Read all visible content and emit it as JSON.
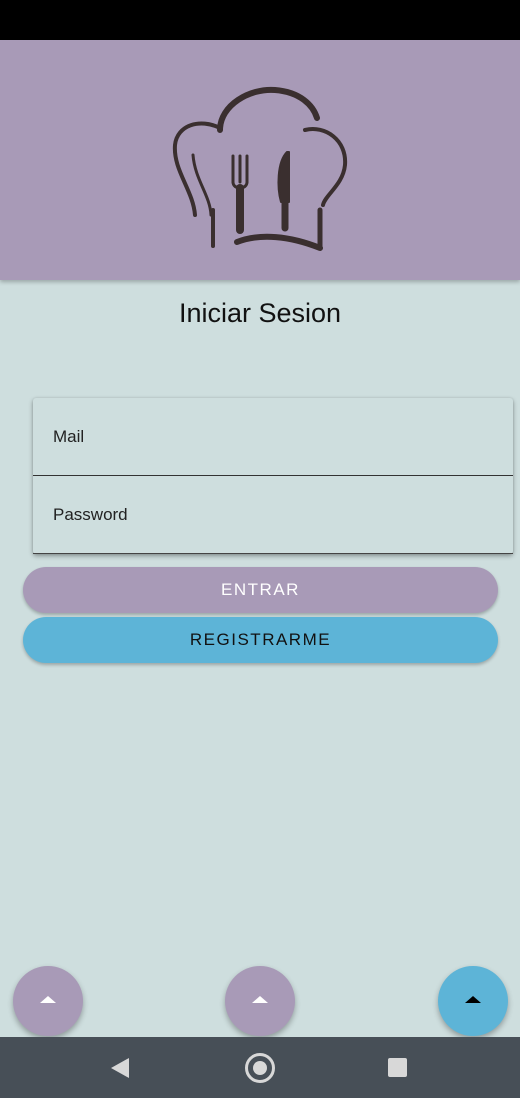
{
  "app": {
    "logo_icon": "chef-hat-fork-knife-icon"
  },
  "login": {
    "title": "Iniciar Sesion",
    "mail_placeholder": "Mail",
    "password_placeholder": "Password",
    "enter_label": "ENTRAR",
    "register_label": "REGISTRARME"
  },
  "fabs": [
    {
      "icon": "arrow-up-icon",
      "color": "#a89ab7"
    },
    {
      "icon": "arrow-up-icon",
      "color": "#a89ab7"
    },
    {
      "icon": "arrow-up-icon",
      "color": "#5db4d7"
    }
  ],
  "navigation": {
    "icons": [
      "back-icon",
      "home-icon",
      "recents-icon"
    ]
  },
  "colors": {
    "header": "#a89ab7",
    "background": "#cedede",
    "accent": "#5db4d7",
    "nav_bar": "#474f57"
  }
}
